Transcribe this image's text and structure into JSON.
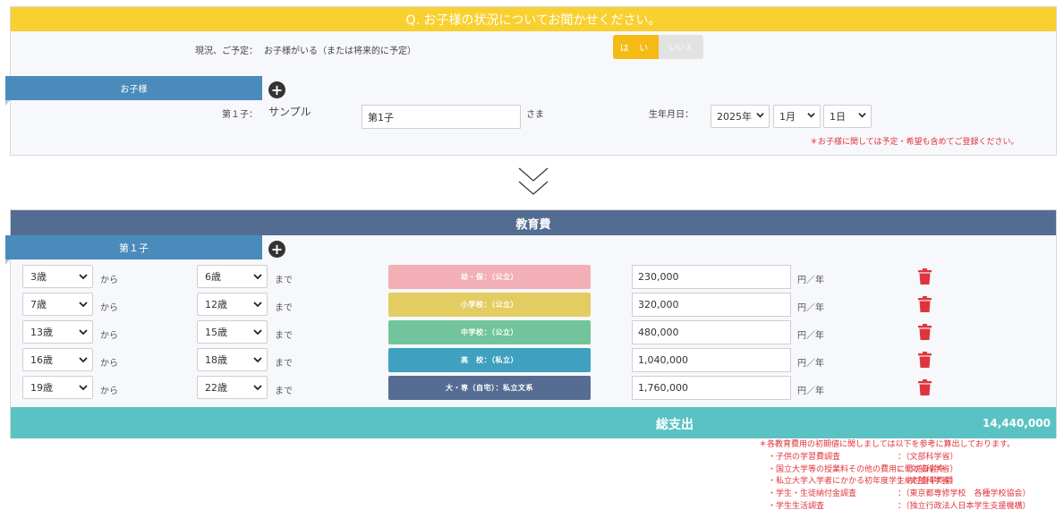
{
  "question": {
    "title": "Q. お子様の状況についてお聞かせください。",
    "status_label": "現況、ご予定：",
    "status_text": "お子様がいる（または将来的に予定）",
    "yes_label": "は い",
    "no_label": "いいえ",
    "tab_label": "お子様",
    "child": {
      "label": "第１子：",
      "sample": "サンプル",
      "name_value": "第1子",
      "suffix": "さま",
      "birth_label": "生年月日：",
      "year": "2025年",
      "month": "1月",
      "day": "1日"
    },
    "note": "＊お子様に関しては予定・希望も含めてご登録ください。"
  },
  "education": {
    "title": "教育費",
    "tab_label": "第１子",
    "from_word": "から",
    "to_word": "まで",
    "unit": "円／年",
    "rows": [
      {
        "from": "3歳",
        "to": "6歳",
        "category": "幼・保：（公立）",
        "color": "#f2b0b6",
        "amount": "230,000"
      },
      {
        "from": "7歳",
        "to": "12歳",
        "category": "小学校：（公立）",
        "color": "#e3cd62",
        "amount": "320,000"
      },
      {
        "from": "13歳",
        "to": "15歳",
        "category": "中学校：（公立）",
        "color": "#72c49c",
        "amount": "480,000"
      },
      {
        "from": "16歳",
        "to": "18歳",
        "category": "高　校：（私立）",
        "color": "#3fa1bf",
        "amount": "1,040,000"
      },
      {
        "from": "19歳",
        "to": "22歳",
        "category": "大・専（自宅）：私立文系",
        "color": "#566d93",
        "amount": "1,760,000"
      }
    ],
    "total_label": "総支出",
    "total_value": "14,440,000"
  },
  "references": {
    "intro": "＊各教育費用の初期値に関しましては以下を参考に算出しております。",
    "items": [
      {
        "name": "・子供の学習費調査",
        "source": "：（文部科学省）"
      },
      {
        "name": "・国立大学等の授業料その他の費用に関する省令",
        "source": "：（文部科学省）"
      },
      {
        "name": "・私立大学入学者にかかる初年度学生納付金平均額",
        "source": "：（文部科学省）"
      },
      {
        "name": "・学生・生徒納付金調査",
        "source": "：（東京都専修学校　各種学校協会）"
      },
      {
        "name": "・学生生活調査",
        "source": "：（独立行政法人日本学生支援機構）"
      }
    ]
  },
  "icons": {
    "plus": "plus-circle-icon",
    "trash": "trash-icon",
    "chevron": "chevron-down-icon",
    "arrow": "double-chevron-down-icon"
  },
  "colors": {
    "question_header": "#f8d030",
    "yes_button": "#f5bb14",
    "tab": "#4a8bbc",
    "edu_header": "#536c92",
    "total_bar": "#5bc2c3",
    "note_red": "#e0343c",
    "trash": "#e0343c"
  }
}
